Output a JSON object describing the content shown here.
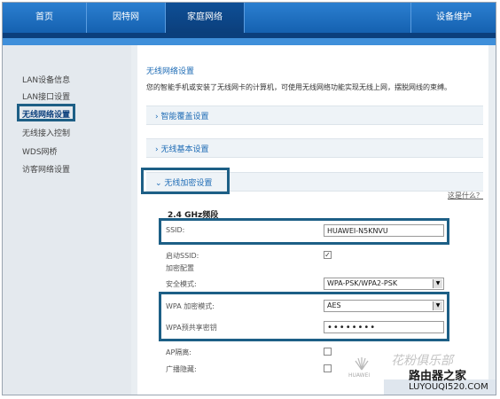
{
  "nav": {
    "tabs": [
      {
        "label": "首页"
      },
      {
        "label": "因特网"
      },
      {
        "label": "家庭网络"
      },
      {
        "label": "设备维护"
      }
    ]
  },
  "sidebar": {
    "items": [
      {
        "label": "LAN设备信息"
      },
      {
        "label": "LAN接口设置"
      },
      {
        "label": "无线网络设置"
      },
      {
        "label": "无线接入控制"
      },
      {
        "label": "WDS网桥"
      },
      {
        "label": "访客网络设置"
      }
    ]
  },
  "main": {
    "title": "无线网络设置",
    "desc": "您的智能手机或安装了无线网卡的计算机，可使用无线网络功能实现无线上网，摆脱网线的束缚。",
    "sections": {
      "smart": "› 智能覆盖设置",
      "basic": "› 无线基本设置",
      "security": "⌄ 无线加密设置"
    },
    "what_is": "这是什么？",
    "band": "2.4 GHz频段",
    "fields": {
      "ssid_label": "SSID:",
      "ssid_value": "HUAWEI-N5KNVU",
      "enable_ssid_label": "启动SSID:",
      "enable_ssid_mark": "✓",
      "encryption_config_label": "加密配置",
      "security_mode_label": "安全模式:",
      "security_mode_value": "WPA-PSK/WPA2-PSK",
      "wpa_mode_label": "WPA 加密模式:",
      "wpa_mode_value": "AES",
      "wpa_key_label": "WPA预共享密钥",
      "wpa_key_value": "••••••••",
      "ap_isolation_label": "AP隔离:",
      "broadcast_hide_label": "广播隐藏:"
    }
  },
  "watermark": {
    "brand_small": "HUAWEI",
    "text1": "花粉俱乐部",
    "text2": "路由器之家",
    "text3": "LUYOUQI520.COM"
  }
}
